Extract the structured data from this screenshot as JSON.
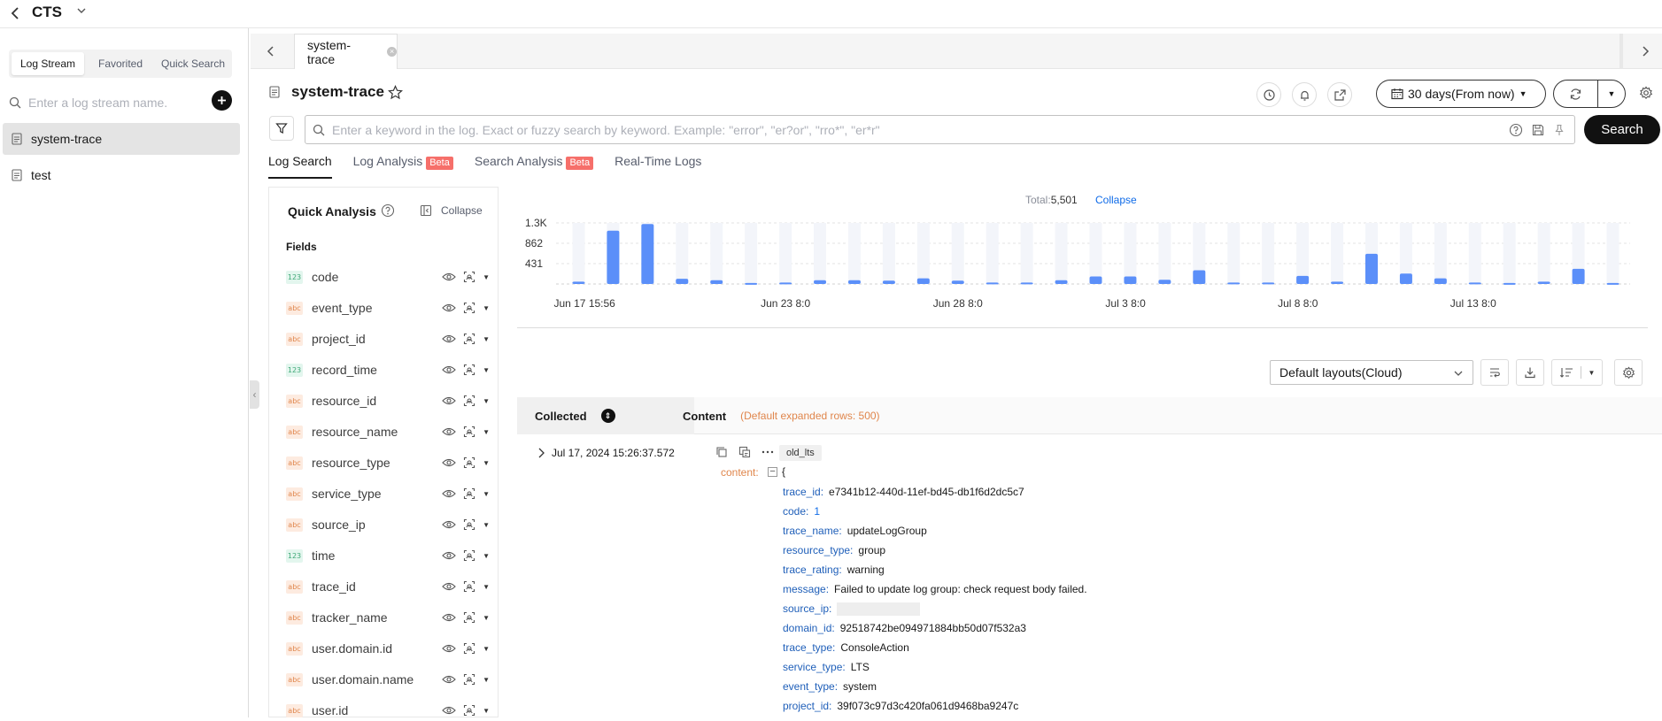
{
  "app": {
    "title": "CTS"
  },
  "sidebar": {
    "tabs": [
      "Log Stream",
      "Favorited",
      "Quick Search"
    ],
    "search_placeholder": "Enter a log stream name.",
    "streams": [
      "system-trace",
      "test"
    ]
  },
  "tabs": {
    "open": [
      {
        "label": "system-trace"
      }
    ]
  },
  "header": {
    "stream_title": "system-trace",
    "time_range": "30 days(From now)"
  },
  "search": {
    "placeholder": "Enter a keyword in the log. Exact or fuzzy search by keyword. Example: \"error\", \"er?or\", \"rro*\", \"er*r\"",
    "button": "Search"
  },
  "subtabs": [
    {
      "label": "Log Search",
      "beta": ""
    },
    {
      "label": "Log Analysis",
      "beta": "Beta"
    },
    {
      "label": "Search Analysis",
      "beta": "Beta"
    },
    {
      "label": "Real-Time Logs",
      "beta": ""
    }
  ],
  "quick_analysis": {
    "title": "Quick Analysis",
    "collapse": "Collapse",
    "fields_label": "Fields",
    "fields": [
      {
        "name": "code",
        "type": "123"
      },
      {
        "name": "event_type",
        "type": "abc"
      },
      {
        "name": "project_id",
        "type": "abc"
      },
      {
        "name": "record_time",
        "type": "123"
      },
      {
        "name": "resource_id",
        "type": "abc"
      },
      {
        "name": "resource_name",
        "type": "abc"
      },
      {
        "name": "resource_type",
        "type": "abc"
      },
      {
        "name": "service_type",
        "type": "abc"
      },
      {
        "name": "source_ip",
        "type": "abc"
      },
      {
        "name": "time",
        "type": "123"
      },
      {
        "name": "trace_id",
        "type": "abc"
      },
      {
        "name": "tracker_name",
        "type": "abc"
      },
      {
        "name": "user.domain.id",
        "type": "abc"
      },
      {
        "name": "user.domain.name",
        "type": "abc"
      },
      {
        "name": "user.id",
        "type": "abc"
      }
    ]
  },
  "chart": {
    "total_label": "Total:",
    "total_value": "5,501",
    "collapse": "Collapse"
  },
  "chart_data": {
    "type": "bar",
    "yticks": [
      "1.3K",
      "862",
      "431"
    ],
    "ytick_values": [
      1293,
      862,
      431
    ],
    "ylim": [
      0,
      1293
    ],
    "xticks": [
      "Jun 17 15:56",
      "Jun 23 8:0",
      "Jun 28 8:0",
      "Jul 3 8:0",
      "Jul 8 8:0",
      "Jul 13 8:0"
    ],
    "xtick_index": [
      0,
      6,
      11,
      16,
      21,
      26
    ],
    "values": [
      50,
      1130,
      1270,
      110,
      80,
      20,
      30,
      80,
      80,
      70,
      120,
      70,
      30,
      30,
      80,
      160,
      160,
      90,
      290,
      30,
      30,
      170,
      50,
      640,
      220,
      120,
      30,
      20,
      50,
      320,
      20
    ],
    "color": "#5b8ff9",
    "grid": true
  },
  "results": {
    "layout": "Default layouts(Cloud)",
    "col_collected": "Collected",
    "col_content": "Content",
    "col_content_hint": "(Default expanded rows: 500)",
    "row": {
      "time": "Jul 17, 2024 15:26:37.572",
      "tag": "old_lts",
      "content_key": "content:",
      "brace": "{",
      "fields": [
        {
          "k": "trace_id:",
          "v": "e7341b12-440d-11ef-bd45-db1f6d2dc5c7"
        },
        {
          "k": "code:",
          "v": "1"
        },
        {
          "k": "trace_name:",
          "v": "updateLogGroup"
        },
        {
          "k": "resource_type:",
          "v": "group"
        },
        {
          "k": "trace_rating:",
          "v": "warning"
        },
        {
          "k": "message:",
          "v": "Failed to update log group: check request body failed."
        },
        {
          "k": "source_ip:",
          "v": ""
        },
        {
          "k": "domain_id:",
          "v": "92518742be094971884bb50d07f532a3"
        },
        {
          "k": "trace_type:",
          "v": "ConsoleAction"
        },
        {
          "k": "service_type:",
          "v": "LTS"
        },
        {
          "k": "event_type:",
          "v": "system"
        },
        {
          "k": "project_id:",
          "v": "39f073c97d3c420fa061d9468ba9247c"
        }
      ]
    }
  }
}
